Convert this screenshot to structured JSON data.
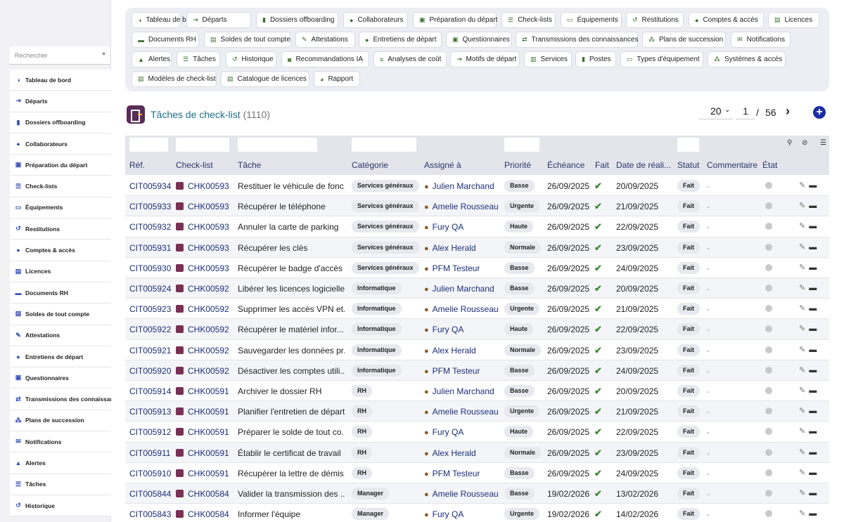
{
  "sidebar": {
    "search_placeholder": "Rechercher",
    "items": [
      {
        "label": "Tableau de bord",
        "icon": "gauge-icon",
        "glyph": "◑"
      },
      {
        "label": "Départs",
        "icon": "exit-icon",
        "glyph": "⇥"
      },
      {
        "label": "Dossiers offboarding",
        "icon": "folder-user-icon",
        "glyph": "▮"
      },
      {
        "label": "Collaborateurs",
        "icon": "user-icon",
        "glyph": "●"
      },
      {
        "label": "Préparation du départ",
        "icon": "clipboard-icon",
        "glyph": "▣"
      },
      {
        "label": "Check-lists",
        "icon": "list-icon",
        "glyph": "☰"
      },
      {
        "label": "Équipements",
        "icon": "laptop-icon",
        "glyph": "▭"
      },
      {
        "label": "Restitutions",
        "icon": "undo-icon",
        "glyph": "↺"
      },
      {
        "label": "Comptes & accès",
        "icon": "users-icon",
        "glyph": "●"
      },
      {
        "label": "Licences",
        "icon": "license-icon",
        "glyph": "▤"
      },
      {
        "label": "Documents RH",
        "icon": "folder-icon",
        "glyph": "▬"
      },
      {
        "label": "Soldes de tout compte",
        "icon": "money-icon",
        "glyph": "▤"
      },
      {
        "label": "Attestations",
        "icon": "certificate-icon",
        "glyph": "✎"
      },
      {
        "label": "Entretiens de départ",
        "icon": "chat-icon",
        "glyph": "●"
      },
      {
        "label": "Questionnaires",
        "icon": "form-icon",
        "glyph": "▣"
      },
      {
        "label": "Transmissions des connaissances",
        "icon": "transfer-icon",
        "glyph": "⇄"
      },
      {
        "label": "Plans de succession",
        "icon": "org-icon",
        "glyph": "⁂"
      },
      {
        "label": "Notifications",
        "icon": "mail-icon",
        "glyph": "✉"
      },
      {
        "label": "Alertes",
        "icon": "bell-icon",
        "glyph": "▲"
      },
      {
        "label": "Tâches",
        "icon": "tasks-icon",
        "glyph": "☰"
      },
      {
        "label": "Historique",
        "icon": "history-icon",
        "glyph": "↺"
      }
    ]
  },
  "nav": [
    {
      "label": "Tableau de bord",
      "icon": "gauge-icon",
      "glyph": "◑"
    },
    {
      "label": "Départs",
      "icon": "exit-icon",
      "glyph": "⇥"
    },
    {
      "label": "Dossiers offboarding",
      "icon": "folder-user-icon",
      "glyph": "▮"
    },
    {
      "label": "Collaborateurs",
      "icon": "user-icon",
      "glyph": "●"
    },
    {
      "label": "Préparation du départ",
      "icon": "clipboard-icon",
      "glyph": "▣"
    },
    {
      "label": "Check-lists",
      "icon": "list-icon",
      "glyph": "☰"
    },
    {
      "label": "Équipements",
      "icon": "laptop-icon",
      "glyph": "▭"
    },
    {
      "label": "Restitutions",
      "icon": "undo-icon",
      "glyph": "↺"
    },
    {
      "label": "Comptes & accès",
      "icon": "users-icon",
      "glyph": "●"
    },
    {
      "label": "Licences",
      "icon": "license-icon",
      "glyph": "▤"
    },
    {
      "label": "Documents RH",
      "icon": "folder-icon",
      "glyph": "▬"
    },
    {
      "label": "Soldes de tout compte",
      "icon": "money-icon",
      "glyph": "▤"
    },
    {
      "label": "Attestations",
      "icon": "certificate-icon",
      "glyph": "✎"
    },
    {
      "label": "Entretiens de départ",
      "icon": "chat-icon",
      "glyph": "●"
    },
    {
      "label": "Questionnaires",
      "icon": "form-icon",
      "glyph": "▣"
    },
    {
      "label": "Transmissions des connaissances",
      "icon": "transfer-icon",
      "glyph": "⇄"
    },
    {
      "label": "Plans de succession",
      "icon": "org-icon",
      "glyph": "⁂"
    },
    {
      "label": "Notifications",
      "icon": "mail-icon",
      "glyph": "✉"
    },
    {
      "label": "Alertes",
      "icon": "bell-icon",
      "glyph": "▲"
    },
    {
      "label": "Tâches",
      "icon": "tasks-icon",
      "glyph": "☰"
    },
    {
      "label": "Historique",
      "icon": "history-icon",
      "glyph": "↺"
    },
    {
      "label": "Recommandations IA",
      "icon": "robot-icon",
      "glyph": "◙"
    },
    {
      "label": "Analyses de coût",
      "icon": "money-stack-icon",
      "glyph": "≡"
    },
    {
      "label": "Motifs de départ",
      "icon": "exit-icon",
      "glyph": "⇥"
    },
    {
      "label": "Services",
      "icon": "building-icon",
      "glyph": "▥"
    },
    {
      "label": "Postes",
      "icon": "badge-icon",
      "glyph": "▮"
    },
    {
      "label": "Types d'équipement",
      "icon": "laptop-icon",
      "glyph": "▭"
    },
    {
      "label": "Systèmes & accès",
      "icon": "network-icon",
      "glyph": "⁂"
    },
    {
      "label": "Modèles de check-list",
      "icon": "template-icon",
      "glyph": "▤"
    },
    {
      "label": "Catalogue de licences",
      "icon": "catalog-icon",
      "glyph": "▤"
    },
    {
      "label": "Rapport",
      "icon": "pie-chart-icon",
      "glyph": "◕"
    }
  ],
  "header": {
    "title": "Tâches de check-list",
    "count": "(1110)",
    "page_size": "20",
    "page_number": "1",
    "page_separator": "/",
    "page_total": "56",
    "add_glyph": "+"
  },
  "table": {
    "columns": [
      "Réf.",
      "Check-list",
      "Tâche",
      "Catégorie",
      "Assigné à",
      "Priorité",
      "Échéance",
      "Fait",
      "Date de réali...",
      "Statut",
      "Commentaire",
      "État"
    ],
    "rows": [
      {
        "ref": "CIT005934",
        "checklist": "CHK00593",
        "task": "Restituer le véhicule de fonc...",
        "category": "Services généraux",
        "assignee": "Julien Marchand",
        "priority": "Basse",
        "due": "26/09/2025",
        "done": "✔",
        "date_done": "20/09/2025",
        "status": "Fait",
        "comment": "-"
      },
      {
        "ref": "CIT005933",
        "checklist": "CHK00593",
        "task": "Récupérer le téléphone",
        "category": "Services généraux",
        "assignee": "Amelie Rousseau",
        "priority": "Urgente",
        "due": "26/09/2025",
        "done": "✔",
        "date_done": "21/09/2025",
        "status": "Fait",
        "comment": "-"
      },
      {
        "ref": "CIT005932",
        "checklist": "CHK00593",
        "task": "Annuler la carte de parking",
        "category": "Services généraux",
        "assignee": "Fury QA",
        "priority": "Haute",
        "due": "26/09/2025",
        "done": "✔",
        "date_done": "22/09/2025",
        "status": "Fait",
        "comment": "-"
      },
      {
        "ref": "CIT005931",
        "checklist": "CHK00593",
        "task": "Récupérer les clés",
        "category": "Services généraux",
        "assignee": "Alex Herald",
        "priority": "Normale",
        "due": "26/09/2025",
        "done": "✔",
        "date_done": "23/09/2025",
        "status": "Fait",
        "comment": "-"
      },
      {
        "ref": "CIT005930",
        "checklist": "CHK00593",
        "task": "Récupérer le badge d'accès",
        "category": "Services généraux",
        "assignee": "PFM Testeur",
        "priority": "Basse",
        "due": "26/09/2025",
        "done": "✔",
        "date_done": "24/09/2025",
        "status": "Fait",
        "comment": "-"
      },
      {
        "ref": "CIT005924",
        "checklist": "CHK00592",
        "task": "Libérer les licences logicielles",
        "category": "Informatique",
        "assignee": "Julien Marchand",
        "priority": "Basse",
        "due": "26/09/2025",
        "done": "✔",
        "date_done": "20/09/2025",
        "status": "Fait",
        "comment": "-"
      },
      {
        "ref": "CIT005923",
        "checklist": "CHK00592",
        "task": "Supprimer les accès VPN et...",
        "category": "Informatique",
        "assignee": "Amelie Rousseau",
        "priority": "Urgente",
        "due": "26/09/2025",
        "done": "✔",
        "date_done": "21/09/2025",
        "status": "Fait",
        "comment": "-"
      },
      {
        "ref": "CIT005922",
        "checklist": "CHK00592",
        "task": "Récupérer le matériel infor...",
        "category": "Informatique",
        "assignee": "Fury QA",
        "priority": "Haute",
        "due": "26/09/2025",
        "done": "✔",
        "date_done": "22/09/2025",
        "status": "Fait",
        "comment": "-"
      },
      {
        "ref": "CIT005921",
        "checklist": "CHK00592",
        "task": "Sauvegarder les données pr...",
        "category": "Informatique",
        "assignee": "Alex Herald",
        "priority": "Normale",
        "due": "26/09/2025",
        "done": "✔",
        "date_done": "23/09/2025",
        "status": "Fait",
        "comment": "-"
      },
      {
        "ref": "CIT005920",
        "checklist": "CHK00592",
        "task": "Désactiver les comptes utili...",
        "category": "Informatique",
        "assignee": "PFM Testeur",
        "priority": "Basse",
        "due": "26/09/2025",
        "done": "✔",
        "date_done": "24/09/2025",
        "status": "Fait",
        "comment": "-"
      },
      {
        "ref": "CIT005914",
        "checklist": "CHK00591",
        "task": "Archiver le dossier RH",
        "category": "RH",
        "assignee": "Julien Marchand",
        "priority": "Basse",
        "due": "26/09/2025",
        "done": "✔",
        "date_done": "20/09/2025",
        "status": "Fait",
        "comment": "-"
      },
      {
        "ref": "CIT005913",
        "checklist": "CHK00591",
        "task": "Planifier l'entretien de départ",
        "category": "RH",
        "assignee": "Amelie Rousseau",
        "priority": "Urgente",
        "due": "26/09/2025",
        "done": "✔",
        "date_done": "21/09/2025",
        "status": "Fait",
        "comment": "-"
      },
      {
        "ref": "CIT005912",
        "checklist": "CHK00591",
        "task": "Préparer le solde de tout co...",
        "category": "RH",
        "assignee": "Fury QA",
        "priority": "Haute",
        "due": "26/09/2025",
        "done": "✔",
        "date_done": "22/09/2025",
        "status": "Fait",
        "comment": "-"
      },
      {
        "ref": "CIT005911",
        "checklist": "CHK00591",
        "task": "Établir le certificat de travail",
        "category": "RH",
        "assignee": "Alex Herald",
        "priority": "Normale",
        "due": "26/09/2025",
        "done": "✔",
        "date_done": "23/09/2025",
        "status": "Fait",
        "comment": "-"
      },
      {
        "ref": "CIT005910",
        "checklist": "CHK00591",
        "task": "Récupérer la lettre de démis...",
        "category": "RH",
        "assignee": "PFM Testeur",
        "priority": "Basse",
        "due": "26/09/2025",
        "done": "✔",
        "date_done": "24/09/2025",
        "status": "Fait",
        "comment": "-"
      },
      {
        "ref": "CIT005844",
        "checklist": "CHK00584",
        "task": "Valider la transmission des ...",
        "category": "Manager",
        "assignee": "Amelie Rousseau",
        "priority": "Basse",
        "due": "19/02/2026",
        "done": "✔",
        "date_done": "13/02/2026",
        "status": "Fait",
        "comment": "-"
      },
      {
        "ref": "CIT005843",
        "checklist": "CHK00584",
        "task": "Informer l'équipe",
        "category": "Manager",
        "assignee": "Fury QA",
        "priority": "Urgente",
        "due": "19/02/2026",
        "done": "✔",
        "date_done": "14/02/2026",
        "status": "Fait",
        "comment": "-"
      }
    ]
  }
}
